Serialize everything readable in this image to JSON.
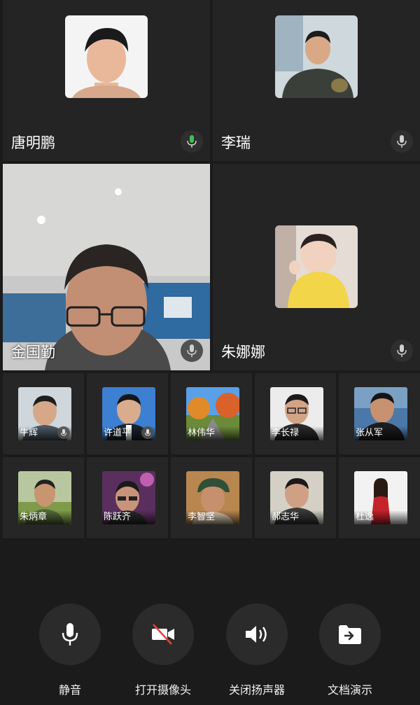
{
  "participants_main": [
    {
      "name": "唐明鹏",
      "mic": "active"
    },
    {
      "name": "李瑞",
      "mic": "muted"
    },
    {
      "name": "金国勤",
      "mic": "muted",
      "video": true
    },
    {
      "name": "朱娜娜",
      "mic": "muted"
    }
  ],
  "participants_grid": [
    {
      "name": "牛辉"
    },
    {
      "name": "许道平"
    },
    {
      "name": "林伟华"
    },
    {
      "name": "李长禄"
    },
    {
      "name": "张从军"
    },
    {
      "name": "朱炳章"
    },
    {
      "name": "陈跃齐"
    },
    {
      "name": "李智坚"
    },
    {
      "name": "郝志华"
    },
    {
      "name": "杜逸"
    }
  ],
  "controls": {
    "mute_label": "静音",
    "camera_label": "打开摄像头",
    "speaker_label": "关闭扬声器",
    "share_label": "文档演示"
  },
  "colors": {
    "background": "#1b1b1b",
    "tile": "#242424",
    "mic_active": "#3cc34d",
    "button": "#2b2b2b",
    "camera_off_slash": "#e0463d"
  }
}
